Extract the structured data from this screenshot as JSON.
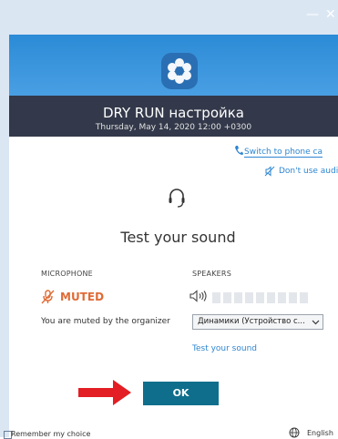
{
  "window": {
    "minimize_glyph": "—",
    "close_glyph": "✕"
  },
  "colors": {
    "header_blue": "#2b8bd6",
    "header_dark": "#33394a",
    "link_blue": "#2e86d1",
    "muted_orange": "#e06b36",
    "ok_button": "#0f6e8c",
    "arrow_red": "#e31e24"
  },
  "meeting": {
    "title": "DRY RUN настройка",
    "date": "Thursday, May 14, 2020   12:00 +0300"
  },
  "links": {
    "switch_to_phone": "Switch to phone ca",
    "dont_use_audio": "Don't use audi"
  },
  "main": {
    "title": "Test your sound"
  },
  "microphone": {
    "label": "MICROPHONE",
    "status": "MUTED",
    "description": "You are muted by the organizer"
  },
  "speakers": {
    "label": "SPEAKERS",
    "level": 0,
    "selected_device": "Динамики (Устройство с...",
    "test_link": "Test your sound"
  },
  "buttons": {
    "ok": "OK"
  },
  "footer": {
    "remember": "Remember my choice",
    "language": "English"
  },
  "icons": {
    "logo": "flower-logo-icon",
    "phone": "phone-icon",
    "no_audio": "speaker-off-icon",
    "headset": "headset-icon",
    "mic_muted": "microphone-muted-icon",
    "speaker": "speaker-icon",
    "globe": "globe-icon",
    "chevron": "chevron-down-icon",
    "arrow": "red-arrow-icon"
  }
}
